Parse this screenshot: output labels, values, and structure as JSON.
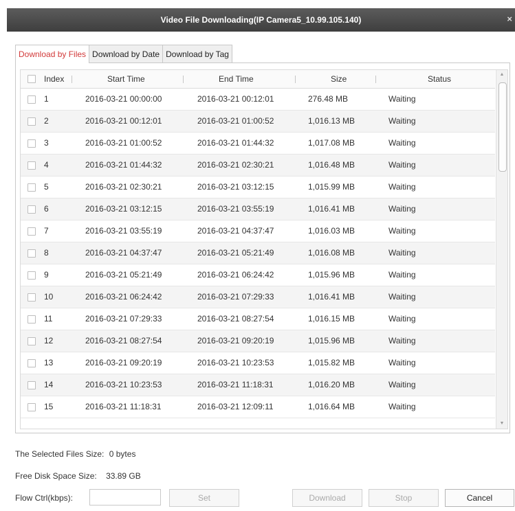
{
  "window": {
    "title": "Video File Downloading(IP Camera5_10.99.105.140)",
    "close_glyph": "×"
  },
  "tabs": [
    {
      "label": "Download by Files",
      "active": true
    },
    {
      "label": "Download by Date",
      "active": false
    },
    {
      "label": "Download by Tag",
      "active": false
    }
  ],
  "table": {
    "columns": {
      "index": "Index",
      "start": "Start Time",
      "end": "End Time",
      "size": "Size",
      "status": "Status"
    },
    "rows": [
      {
        "index": "1",
        "start": "2016-03-21 00:00:00",
        "end": "2016-03-21 00:12:01",
        "size": "276.48 MB",
        "status": "Waiting"
      },
      {
        "index": "2",
        "start": "2016-03-21 00:12:01",
        "end": "2016-03-21 01:00:52",
        "size": "1,016.13 MB",
        "status": "Waiting"
      },
      {
        "index": "3",
        "start": "2016-03-21 01:00:52",
        "end": "2016-03-21 01:44:32",
        "size": "1,017.08 MB",
        "status": "Waiting"
      },
      {
        "index": "4",
        "start": "2016-03-21 01:44:32",
        "end": "2016-03-21 02:30:21",
        "size": "1,016.48 MB",
        "status": "Waiting"
      },
      {
        "index": "5",
        "start": "2016-03-21 02:30:21",
        "end": "2016-03-21 03:12:15",
        "size": "1,015.99 MB",
        "status": "Waiting"
      },
      {
        "index": "6",
        "start": "2016-03-21 03:12:15",
        "end": "2016-03-21 03:55:19",
        "size": "1,016.41 MB",
        "status": "Waiting"
      },
      {
        "index": "7",
        "start": "2016-03-21 03:55:19",
        "end": "2016-03-21 04:37:47",
        "size": "1,016.03 MB",
        "status": "Waiting"
      },
      {
        "index": "8",
        "start": "2016-03-21 04:37:47",
        "end": "2016-03-21 05:21:49",
        "size": "1,016.08 MB",
        "status": "Waiting"
      },
      {
        "index": "9",
        "start": "2016-03-21 05:21:49",
        "end": "2016-03-21 06:24:42",
        "size": "1,015.96 MB",
        "status": "Waiting"
      },
      {
        "index": "10",
        "start": "2016-03-21 06:24:42",
        "end": "2016-03-21 07:29:33",
        "size": "1,016.41 MB",
        "status": "Waiting"
      },
      {
        "index": "11",
        "start": "2016-03-21 07:29:33",
        "end": "2016-03-21 08:27:54",
        "size": "1,016.15 MB",
        "status": "Waiting"
      },
      {
        "index": "12",
        "start": "2016-03-21 08:27:54",
        "end": "2016-03-21 09:20:19",
        "size": "1,015.96 MB",
        "status": "Waiting"
      },
      {
        "index": "13",
        "start": "2016-03-21 09:20:19",
        "end": "2016-03-21 10:23:53",
        "size": "1,015.82 MB",
        "status": "Waiting"
      },
      {
        "index": "14",
        "start": "2016-03-21 10:23:53",
        "end": "2016-03-21 11:18:31",
        "size": "1,016.20 MB",
        "status": "Waiting"
      },
      {
        "index": "15",
        "start": "2016-03-21 11:18:31",
        "end": "2016-03-21 12:09:11",
        "size": "1,016.64 MB",
        "status": "Waiting"
      }
    ]
  },
  "scrollbar": {
    "up_glyph": "▲",
    "down_glyph": "▼"
  },
  "footer": {
    "selected_size_label": "The Selected Files Size:",
    "selected_size_value": "0 bytes",
    "free_space_label": "Free Disk Space Size:",
    "free_space_value": "33.89 GB",
    "flow_ctrl_label": "Flow Ctrl(kbps):",
    "flow_ctrl_value": "",
    "set_label": "Set",
    "download_label": "Download",
    "stop_label": "Stop",
    "cancel_label": "Cancel"
  },
  "colors": {
    "titlebar": "#4a4a4a",
    "active_tab_text": "#d23a3a",
    "row_alt": "#f4f4f4"
  }
}
